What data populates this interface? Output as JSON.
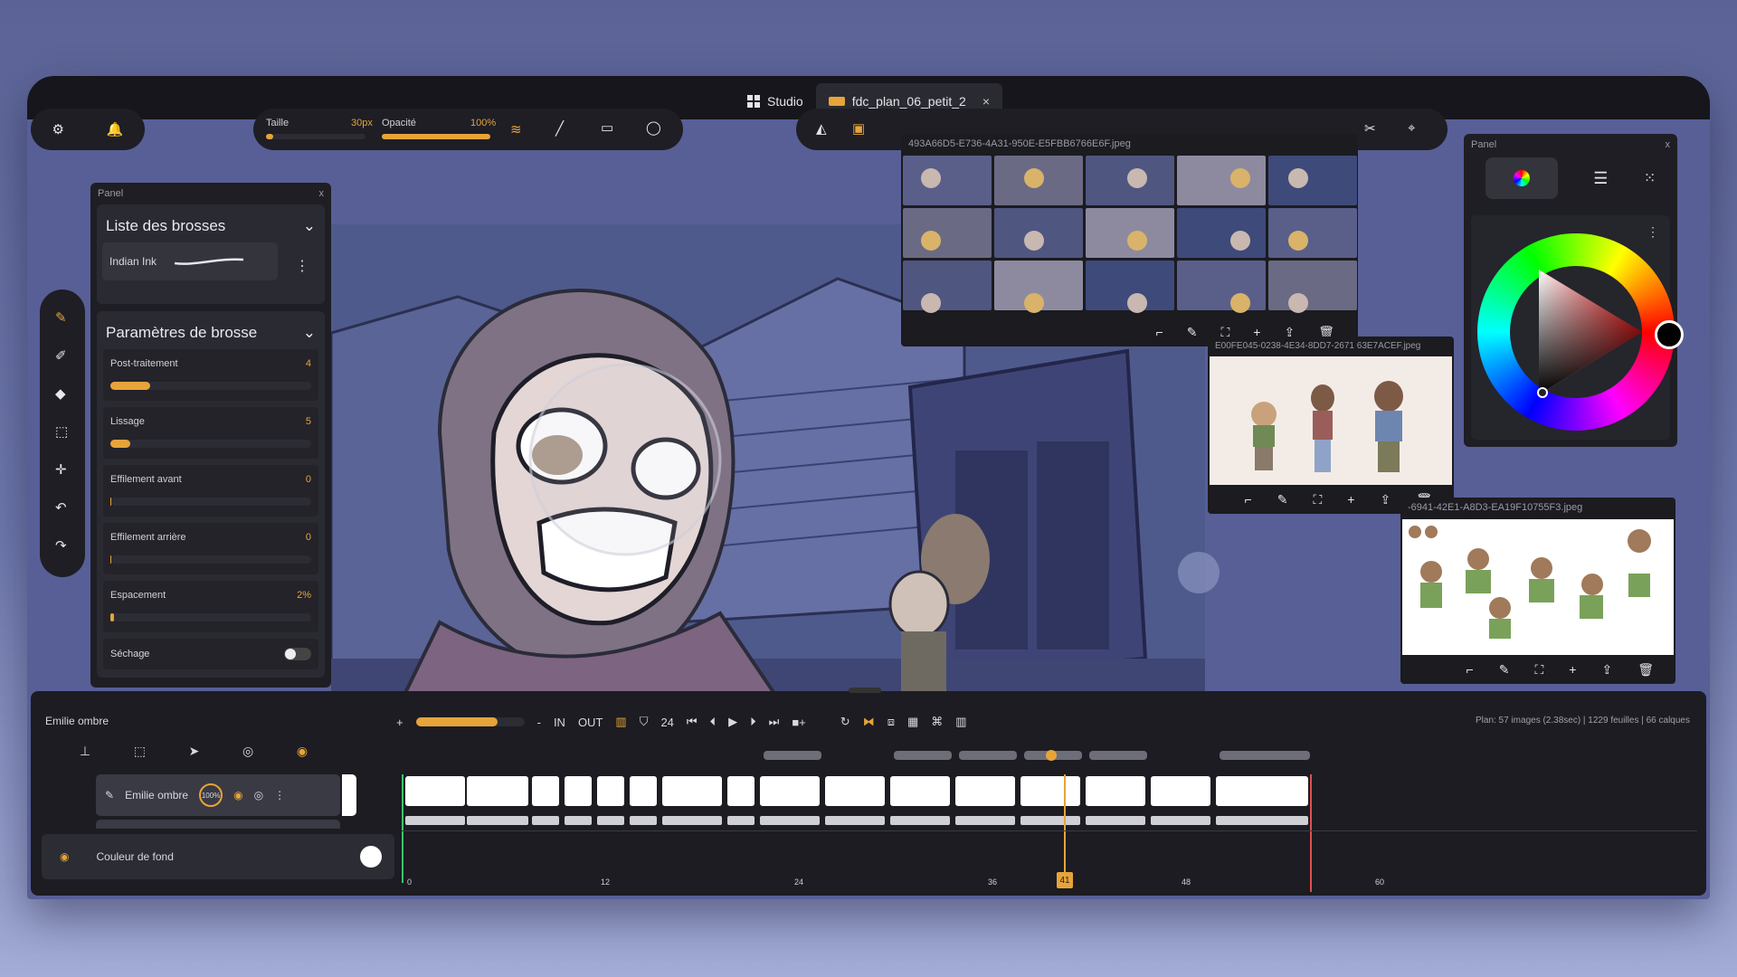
{
  "tabs": [
    {
      "label": "Studio",
      "icon": "grid-icon"
    },
    {
      "label": "fdc_plan_06_petit_2",
      "icon": "film-icon",
      "close": "×"
    }
  ],
  "toolbar": {
    "size_label": "Taille",
    "size_value": "30px",
    "opacity_label": "Opacité",
    "opacity_value": "100%",
    "size_level": 0.03,
    "opacity_level": 1.0
  },
  "brush_panel": {
    "header": "Panel",
    "close": "x",
    "brush_list_title": "Liste des brosses",
    "brush_name": "Indian Ink",
    "params_title": "Paramètres de brosse",
    "params": [
      {
        "label": "Post-traitement",
        "value": "4",
        "level": 0.2
      },
      {
        "label": "Lissage",
        "value": "5",
        "level": 0.1
      },
      {
        "label": "Effilement avant",
        "value": "0",
        "level": 0
      },
      {
        "label": "Effilement arrière",
        "value": "0",
        "level": 0
      },
      {
        "label": "Espacement",
        "value": "2%",
        "level": 0.02
      }
    ],
    "drying_label": "Séchage"
  },
  "color_panel": {
    "header": "Panel",
    "close": "x",
    "accent": "#e6a43a"
  },
  "image_windows": [
    {
      "title": "493A66D5-E736-4A31-950E-E5FBB6766E6F.jpeg"
    },
    {
      "title": "E00FE045-0238-4E34-8DD7-2671 63E7ACEF.jpeg"
    },
    {
      "title": "-6941-42E1-A8D3-EA19F10755F3.jpeg"
    }
  ],
  "timeline": {
    "layer_title": "Emilie ombre",
    "transport": {
      "in": "IN",
      "out": "OUT",
      "fps": "24",
      "plus": "+",
      "minus": "-"
    },
    "plan_info": "Plan: 57 images (2.38sec) | 1229 feuilles | 66 calques",
    "layer_name": "Emilie ombre",
    "layer_opacity": "100%",
    "bg_layer": "Couleur de fond",
    "ticks": [
      "0",
      "12",
      "24",
      "36",
      "48",
      "60"
    ],
    "current_frame": "41"
  }
}
